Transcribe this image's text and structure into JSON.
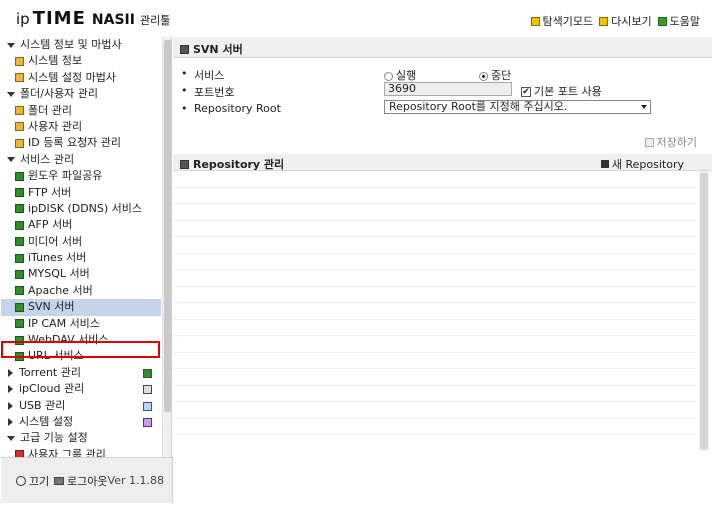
{
  "header": {
    "logo_ip": "ip",
    "logo_time": "TIME",
    "logo_nas": "NASII",
    "logo_suffix": "관리툴",
    "links": [
      "탐색기모드",
      "다시보기",
      "도움말"
    ]
  },
  "sidebar": {
    "groups": [
      {
        "label": "시스템 정보 및 마법사",
        "items": [
          "시스템 정보",
          "시스템 설정 마법사"
        ]
      },
      {
        "label": "폴더/사용자 관리",
        "items": [
          "폴더 관리",
          "사용자 관리",
          "ID 등록 요청자 관리"
        ]
      },
      {
        "label": "서비스 관리",
        "items": [
          "윈도우 파일공유",
          "FTP 서버",
          "ipDISK (DDNS) 서비스",
          "AFP 서버",
          "미디어 서버",
          "iTunes 서버",
          "MYSQL 서버",
          "Apache 서버",
          "SVN 서버",
          "IP CAM 서비스",
          "WebDAV 서비스",
          "URL 서비스"
        ]
      },
      {
        "label": "Torrent 관리"
      },
      {
        "label": "ipCloud 관리"
      },
      {
        "label": "USB 관리"
      },
      {
        "label": "시스템 설정"
      },
      {
        "label": "고급 기능 설정",
        "items": [
          "사용자 그룹 관리"
        ]
      }
    ],
    "selected": "SVN 서버"
  },
  "footer": {
    "exit_label": "끄기",
    "logout_label": "로그아웃",
    "version": "Ver 1.1.88"
  },
  "main": {
    "title": "SVN 서버",
    "service_label": "서비스",
    "run_label": "실행",
    "stop_label": "중단",
    "service_state": "중단",
    "port_label": "포트번호",
    "port_value": "3690",
    "default_port_label": "기본 포트 사용",
    "default_port_checked": true,
    "repo_root_label": "Repository Root",
    "repo_root_placeholder": "Repository Root를 지정해 주십시오.",
    "save_label": "저장하기",
    "repo_section_title": "Repository 관리",
    "new_repo_label": "새 Repository"
  }
}
